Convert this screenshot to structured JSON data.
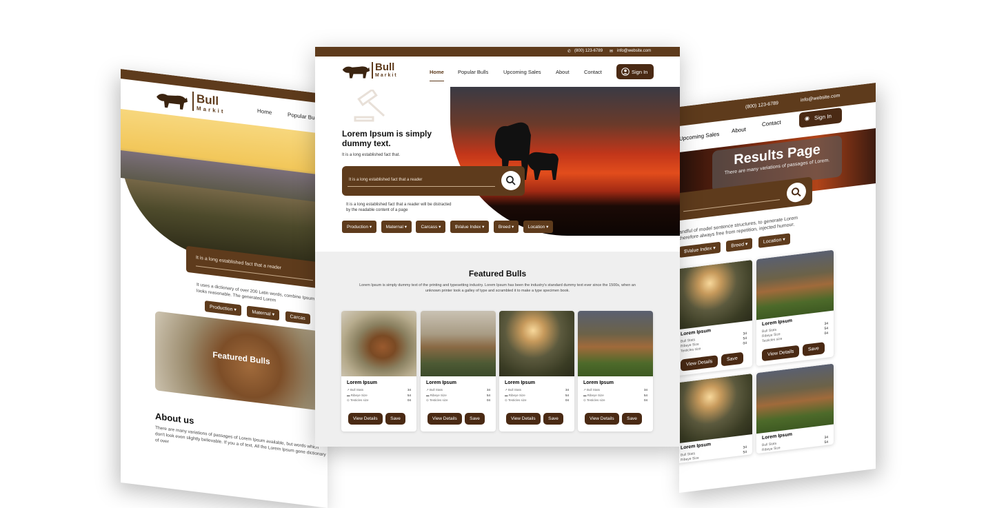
{
  "brand": {
    "name": "Bull",
    "sub": "Markit"
  },
  "contact": {
    "phone": "(800) 123-6789",
    "email": "info@website.com"
  },
  "nav": [
    "Home",
    "Popular Bulls",
    "Upcoming Sales",
    "About",
    "Contact"
  ],
  "signin": "Sign In",
  "hero": {
    "title": "Lorem Ipsum is simply dummy text.",
    "subtitle": "It is a long established fact that.",
    "search_placeholder": "It is a long established fact that a reader",
    "desc": "It is a long established fact that a reader will be distracted by the readable content of a page"
  },
  "filters": [
    "Production",
    "Maternal",
    "Carcass",
    "$Value Index",
    "Breed",
    "Location"
  ],
  "featured": {
    "title": "Featured Bulls",
    "desc": "Lorem Ipsum is simply dummy text of the printing and typesetting industry. Lorem Ipsum has been the industry's standard dummy text ever since the 1500s, when an unknown printer took a galley of type and scrambled it to make a type specimen book."
  },
  "card": {
    "name": "Lorem Ipsum",
    "stats": [
      {
        "label": "Bull Stats",
        "value": "34"
      },
      {
        "label": "Ribeye Size",
        "value": "54"
      },
      {
        "label": "Testicles size",
        "value": "04"
      }
    ],
    "view": "View Details",
    "save": "Save"
  },
  "left": {
    "nav": [
      "Home",
      "Popular Bu"
    ],
    "search": "It is a long established fact that a reader",
    "para": "It uses a dictionary of over 200 Latin words, combine Ipsum which looks reasonable. The generated Lorem",
    "filters": [
      "Production",
      "Maternal",
      "Carcas"
    ],
    "featured": "Featured Bulls",
    "about_title": "About us",
    "about_text": "There are many variations of passages of Lorem Ipsum available, but words which don't look even slightly believable. If you a of text. All the Lorem Ipsum gene dictionary of over"
  },
  "right": {
    "nav": [
      "Upcoming Sales",
      "About",
      "Contact"
    ],
    "results_title": "Results Page",
    "results_sub": "There are many variations of passages of Lorem.",
    "para": "andful of model sentence structures, to generate Lorem therefore always free from repetition, injected humour.",
    "filters": [
      "$Value Index",
      "Breed",
      "Location"
    ]
  }
}
